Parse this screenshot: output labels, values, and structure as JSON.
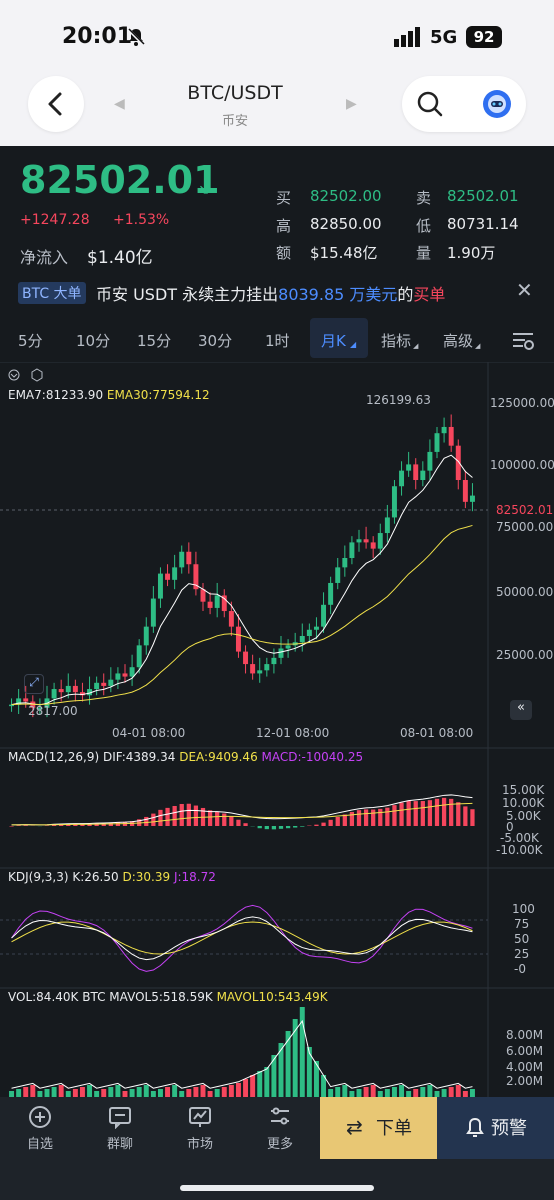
{
  "status_bar": {
    "time": "20:01",
    "network": "5G",
    "battery": "92"
  },
  "header": {
    "pair": "BTC/USDT",
    "exchange": "币安"
  },
  "quote": {
    "price": "82502.01",
    "change": "+1247.28",
    "change_pct": "+1.53%",
    "net_inflow_label": "净流入",
    "net_inflow_value": "$1.40亿",
    "buy_label": "买",
    "buy_value": "82502.00",
    "sell_label": "卖",
    "sell_value": "82502.01",
    "high_label": "高",
    "high_value": "82850.00",
    "low_label": "低",
    "low_value": "80731.14",
    "amount_label": "额",
    "amount_value": "$15.48亿",
    "volume_label": "量",
    "volume_value": "1.90万"
  },
  "banner": {
    "tag": "BTC 大单",
    "text_pre": "币安 USDT 永续主力挂出",
    "amount": "8039.85 万美元",
    "text_mid": "的",
    "side": "买单"
  },
  "tabs": [
    "5分",
    "10分",
    "15分",
    "30分",
    "1时",
    "月K",
    "指标",
    "高级"
  ],
  "active_tab": "月K",
  "main_chart": {
    "ema_label": "EMA7:81233.90",
    "ema30_label": "EMA30:77594.12",
    "y_ticks": [
      "125000.00",
      "100000.00",
      "75000.00",
      "50000.00",
      "25000.00"
    ],
    "current_price_tag": "82502.01",
    "high_marker": "126199.63",
    "low_marker": "2817.00",
    "x_ticks": [
      "04-01 08:00",
      "12-01 08:00",
      "08-01 08:00"
    ]
  },
  "macd": {
    "title": "MACD(12,26,9)",
    "dif": "DIF:4389.34",
    "dea": "DEA:9409.46",
    "macd": "MACD:-10040.25",
    "y_ticks": [
      "15.00K",
      "10.00K",
      "5.00K",
      "0",
      "-5.00K",
      "-10.00K"
    ]
  },
  "kdj": {
    "title": "KDJ(9,3,3)",
    "k": "K:26.50",
    "d": "D:30.39",
    "j": "J:18.72",
    "y_ticks": [
      "100",
      "75",
      "50",
      "25",
      "-0"
    ]
  },
  "vol": {
    "title": "VOL:84.40K BTC",
    "ma5": "MAVOL5:518.59K",
    "ma10": "MAVOL10:543.49K",
    "y_ticks": [
      "8.00M",
      "6.00M",
      "4.00M",
      "2.00M"
    ]
  },
  "nav": {
    "items": [
      "自选",
      "群聊",
      "市场",
      "更多"
    ],
    "order": "下单",
    "alert": "预警"
  },
  "colors": {
    "up": "#2ebd85",
    "down": "#f6465d",
    "ema7": "#ffffff",
    "ema30": "#f0e04a",
    "macd_dea": "#f0e04a",
    "kdj_j": "#c542f5",
    "order_bg": "#e8c774"
  }
}
